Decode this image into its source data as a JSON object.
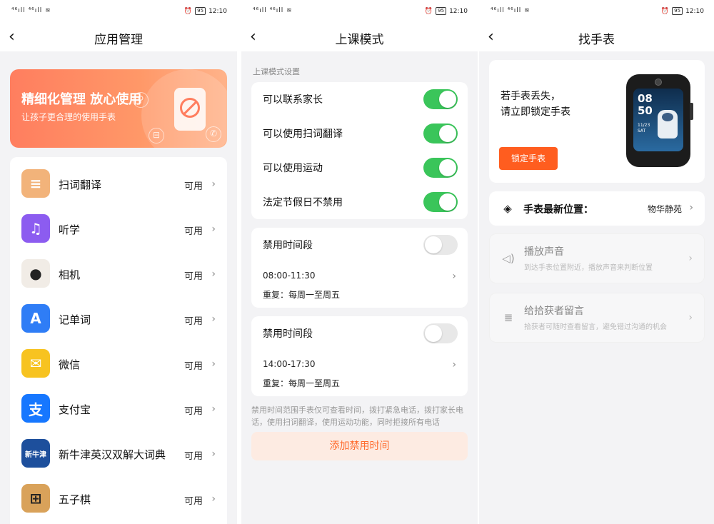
{
  "status_bar": {
    "left": "⁴⁶ıll ⁴⁶ıll ≋",
    "battery": "95",
    "time": "12:10"
  },
  "screen1": {
    "title": "应用管理",
    "banner": {
      "title": "精细化管理 放心使用",
      "subtitle": "让孩子更合理的使用手表"
    },
    "apps": [
      {
        "name": "扫词翻译",
        "status": "可用",
        "color": "#f2b37a",
        "glyph": "≡"
      },
      {
        "name": "听学",
        "status": "可用",
        "color": "#8c5cf0",
        "glyph": "♫"
      },
      {
        "name": "相机",
        "status": "可用",
        "color": "#f1ece6",
        "glyph": "●"
      },
      {
        "name": "记单词",
        "status": "可用",
        "color": "#2f7df6",
        "glyph": "A"
      },
      {
        "name": "微信",
        "status": "可用",
        "color": "#f7c320",
        "glyph": "✉"
      },
      {
        "name": "支付宝",
        "status": "可用",
        "color": "#1677ff",
        "glyph": "支"
      },
      {
        "name": "新牛津英汉双解大词典",
        "status": "可用",
        "color": "#1d4f9c",
        "glyph": "新牛津"
      },
      {
        "name": "五子棋",
        "status": "可用",
        "color": "#d9a25a",
        "glyph": "⊞"
      }
    ]
  },
  "screen2": {
    "title": "上课模式",
    "section_label": "上课模式设置",
    "options": [
      {
        "label": "可以联系家长",
        "on": true
      },
      {
        "label": "可以使用扫词翻译",
        "on": true
      },
      {
        "label": "可以使用运动",
        "on": true
      },
      {
        "label": "法定节假日不禁用",
        "on": true
      }
    ],
    "periods": [
      {
        "title": "禁用时间段",
        "on": false,
        "range": "08:00-11:30",
        "repeat": "重复：每周一至周五"
      },
      {
        "title": "禁用时间段",
        "on": false,
        "range": "14:00-17:30",
        "repeat": "重复：每周一至周五"
      }
    ],
    "note": "禁用时间范围手表仅可查看时间，拨打紧急电话，拨打家长电话，使用扫词翻译，使用运动功能，同时拒接所有电话",
    "add_button": "添加禁用时间"
  },
  "screen3": {
    "title": "找手表",
    "lost_text_1": "若手表丢失，",
    "lost_text_2": "请立即锁定手表",
    "lock_button": "锁定手表",
    "watch_face": {
      "hour": "08",
      "minute": "50",
      "date": "11/23",
      "day": "SAT"
    },
    "location_label": "手表最新位置：",
    "location_value": "物华静苑",
    "actions": [
      {
        "title": "播放声音",
        "subtitle": "到达手表位置附近，播放声音来判断位置",
        "icon": "speaker-icon",
        "glyph": "🔈"
      },
      {
        "title": "给拾获者留言",
        "subtitle": "拾获者可随时查看留言，避免错过沟通的机会",
        "icon": "note-icon",
        "glyph": "≣"
      }
    ]
  }
}
